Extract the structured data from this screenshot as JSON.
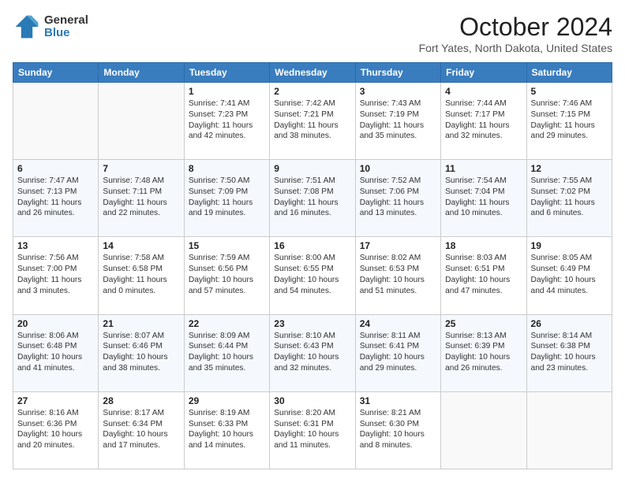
{
  "logo": {
    "general": "General",
    "blue": "Blue"
  },
  "header": {
    "month": "October 2024",
    "location": "Fort Yates, North Dakota, United States"
  },
  "weekdays": [
    "Sunday",
    "Monday",
    "Tuesday",
    "Wednesday",
    "Thursday",
    "Friday",
    "Saturday"
  ],
  "weeks": [
    [
      {
        "day": "",
        "sunrise": "",
        "sunset": "",
        "daylight": ""
      },
      {
        "day": "",
        "sunrise": "",
        "sunset": "",
        "daylight": ""
      },
      {
        "day": "1",
        "sunrise": "Sunrise: 7:41 AM",
        "sunset": "Sunset: 7:23 PM",
        "daylight": "Daylight: 11 hours and 42 minutes."
      },
      {
        "day": "2",
        "sunrise": "Sunrise: 7:42 AM",
        "sunset": "Sunset: 7:21 PM",
        "daylight": "Daylight: 11 hours and 38 minutes."
      },
      {
        "day": "3",
        "sunrise": "Sunrise: 7:43 AM",
        "sunset": "Sunset: 7:19 PM",
        "daylight": "Daylight: 11 hours and 35 minutes."
      },
      {
        "day": "4",
        "sunrise": "Sunrise: 7:44 AM",
        "sunset": "Sunset: 7:17 PM",
        "daylight": "Daylight: 11 hours and 32 minutes."
      },
      {
        "day": "5",
        "sunrise": "Sunrise: 7:46 AM",
        "sunset": "Sunset: 7:15 PM",
        "daylight": "Daylight: 11 hours and 29 minutes."
      }
    ],
    [
      {
        "day": "6",
        "sunrise": "Sunrise: 7:47 AM",
        "sunset": "Sunset: 7:13 PM",
        "daylight": "Daylight: 11 hours and 26 minutes."
      },
      {
        "day": "7",
        "sunrise": "Sunrise: 7:48 AM",
        "sunset": "Sunset: 7:11 PM",
        "daylight": "Daylight: 11 hours and 22 minutes."
      },
      {
        "day": "8",
        "sunrise": "Sunrise: 7:50 AM",
        "sunset": "Sunset: 7:09 PM",
        "daylight": "Daylight: 11 hours and 19 minutes."
      },
      {
        "day": "9",
        "sunrise": "Sunrise: 7:51 AM",
        "sunset": "Sunset: 7:08 PM",
        "daylight": "Daylight: 11 hours and 16 minutes."
      },
      {
        "day": "10",
        "sunrise": "Sunrise: 7:52 AM",
        "sunset": "Sunset: 7:06 PM",
        "daylight": "Daylight: 11 hours and 13 minutes."
      },
      {
        "day": "11",
        "sunrise": "Sunrise: 7:54 AM",
        "sunset": "Sunset: 7:04 PM",
        "daylight": "Daylight: 11 hours and 10 minutes."
      },
      {
        "day": "12",
        "sunrise": "Sunrise: 7:55 AM",
        "sunset": "Sunset: 7:02 PM",
        "daylight": "Daylight: 11 hours and 6 minutes."
      }
    ],
    [
      {
        "day": "13",
        "sunrise": "Sunrise: 7:56 AM",
        "sunset": "Sunset: 7:00 PM",
        "daylight": "Daylight: 11 hours and 3 minutes."
      },
      {
        "day": "14",
        "sunrise": "Sunrise: 7:58 AM",
        "sunset": "Sunset: 6:58 PM",
        "daylight": "Daylight: 11 hours and 0 minutes."
      },
      {
        "day": "15",
        "sunrise": "Sunrise: 7:59 AM",
        "sunset": "Sunset: 6:56 PM",
        "daylight": "Daylight: 10 hours and 57 minutes."
      },
      {
        "day": "16",
        "sunrise": "Sunrise: 8:00 AM",
        "sunset": "Sunset: 6:55 PM",
        "daylight": "Daylight: 10 hours and 54 minutes."
      },
      {
        "day": "17",
        "sunrise": "Sunrise: 8:02 AM",
        "sunset": "Sunset: 6:53 PM",
        "daylight": "Daylight: 10 hours and 51 minutes."
      },
      {
        "day": "18",
        "sunrise": "Sunrise: 8:03 AM",
        "sunset": "Sunset: 6:51 PM",
        "daylight": "Daylight: 10 hours and 47 minutes."
      },
      {
        "day": "19",
        "sunrise": "Sunrise: 8:05 AM",
        "sunset": "Sunset: 6:49 PM",
        "daylight": "Daylight: 10 hours and 44 minutes."
      }
    ],
    [
      {
        "day": "20",
        "sunrise": "Sunrise: 8:06 AM",
        "sunset": "Sunset: 6:48 PM",
        "daylight": "Daylight: 10 hours and 41 minutes."
      },
      {
        "day": "21",
        "sunrise": "Sunrise: 8:07 AM",
        "sunset": "Sunset: 6:46 PM",
        "daylight": "Daylight: 10 hours and 38 minutes."
      },
      {
        "day": "22",
        "sunrise": "Sunrise: 8:09 AM",
        "sunset": "Sunset: 6:44 PM",
        "daylight": "Daylight: 10 hours and 35 minutes."
      },
      {
        "day": "23",
        "sunrise": "Sunrise: 8:10 AM",
        "sunset": "Sunset: 6:43 PM",
        "daylight": "Daylight: 10 hours and 32 minutes."
      },
      {
        "day": "24",
        "sunrise": "Sunrise: 8:11 AM",
        "sunset": "Sunset: 6:41 PM",
        "daylight": "Daylight: 10 hours and 29 minutes."
      },
      {
        "day": "25",
        "sunrise": "Sunrise: 8:13 AM",
        "sunset": "Sunset: 6:39 PM",
        "daylight": "Daylight: 10 hours and 26 minutes."
      },
      {
        "day": "26",
        "sunrise": "Sunrise: 8:14 AM",
        "sunset": "Sunset: 6:38 PM",
        "daylight": "Daylight: 10 hours and 23 minutes."
      }
    ],
    [
      {
        "day": "27",
        "sunrise": "Sunrise: 8:16 AM",
        "sunset": "Sunset: 6:36 PM",
        "daylight": "Daylight: 10 hours and 20 minutes."
      },
      {
        "day": "28",
        "sunrise": "Sunrise: 8:17 AM",
        "sunset": "Sunset: 6:34 PM",
        "daylight": "Daylight: 10 hours and 17 minutes."
      },
      {
        "day": "29",
        "sunrise": "Sunrise: 8:19 AM",
        "sunset": "Sunset: 6:33 PM",
        "daylight": "Daylight: 10 hours and 14 minutes."
      },
      {
        "day": "30",
        "sunrise": "Sunrise: 8:20 AM",
        "sunset": "Sunset: 6:31 PM",
        "daylight": "Daylight: 10 hours and 11 minutes."
      },
      {
        "day": "31",
        "sunrise": "Sunrise: 8:21 AM",
        "sunset": "Sunset: 6:30 PM",
        "daylight": "Daylight: 10 hours and 8 minutes."
      },
      {
        "day": "",
        "sunrise": "",
        "sunset": "",
        "daylight": ""
      },
      {
        "day": "",
        "sunrise": "",
        "sunset": "",
        "daylight": ""
      }
    ]
  ]
}
